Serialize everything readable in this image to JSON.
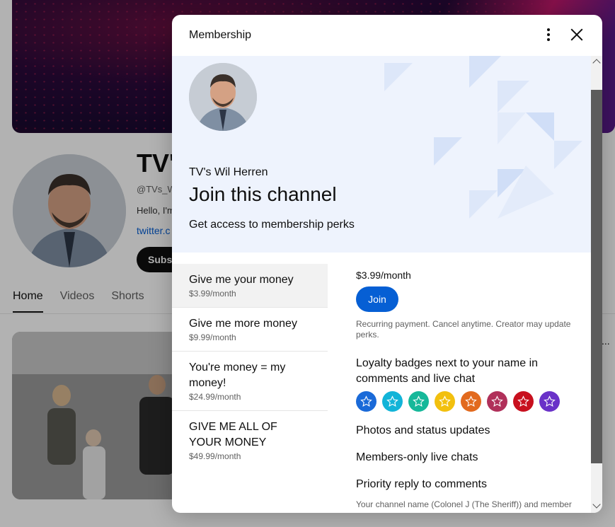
{
  "page": {
    "channel_title": "TV's",
    "handle": "@TVs_W",
    "description": "Hello, I'm",
    "link": "twitter.c",
    "subscribe_label": "Subsc",
    "tabs": [
      {
        "label": "Home",
        "active": true
      },
      {
        "label": "Videos",
        "active": false
      },
      {
        "label": "Shorts",
        "active": false
      }
    ],
    "more_label": "..."
  },
  "dialog": {
    "title": "Membership",
    "more_icon": "kebab-menu-icon",
    "close_icon": "close-icon",
    "hero": {
      "channel_name": "TV's Wil Herren",
      "heading": "Join this channel",
      "subheading": "Get access to membership perks"
    },
    "tiers": [
      {
        "name": "Give me your money",
        "price": "$3.99/month",
        "selected": true
      },
      {
        "name": "Give me more money",
        "price": "$9.99/month",
        "selected": false
      },
      {
        "name": "You're money = my money!",
        "price": "$24.99/month",
        "selected": false
      },
      {
        "name": "GIVE ME ALL OF YOUR MONEY",
        "price": "$49.99/month",
        "selected": false
      }
    ],
    "detail": {
      "price": "$3.99/month",
      "join_label": "Join",
      "note": "Recurring payment. Cancel anytime. Creator may update perks.",
      "loyalty": "Loyalty badges next to your name in comments and live chat",
      "badge_colors": [
        "#1a6ad8",
        "#12b4d8",
        "#16b89a",
        "#f2c00e",
        "#e26a1e",
        "#b0305a",
        "#c8101e",
        "#6a32c8"
      ],
      "perks": [
        "Photos and status updates",
        "Members-only live chats",
        "Priority reply to comments"
      ],
      "footnote": "Your channel name (Colonel J (The Sheriff)) and member"
    }
  },
  "colors": {
    "accent": "#065fd4",
    "hero_bg": "#eef3fd"
  }
}
